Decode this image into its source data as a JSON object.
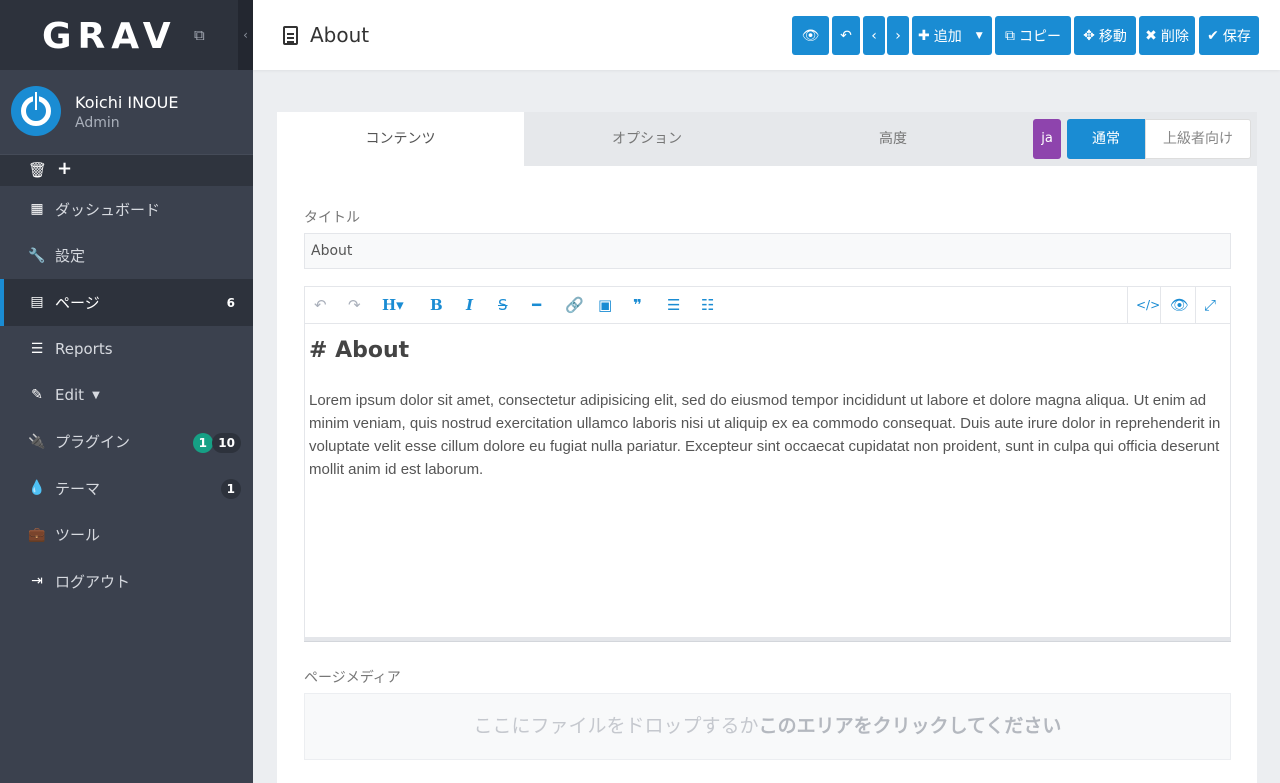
{
  "sidebar": {
    "logo": "GRAV",
    "user": {
      "name": "Koichi INOUE",
      "role": "Admin"
    },
    "items": [
      {
        "label": "ダッシュボード",
        "icon": "grid-icon"
      },
      {
        "label": "設定",
        "icon": "wrench-icon"
      },
      {
        "label": "ページ",
        "icon": "file-icon",
        "badge": "6",
        "active": true
      },
      {
        "label": "Reports",
        "icon": "list-icon"
      },
      {
        "label": "Edit",
        "icon": "edit-icon"
      },
      {
        "label": "プラグイン",
        "icon": "plug-icon",
        "badge_green": "1",
        "badge": "10"
      },
      {
        "label": "テーマ",
        "icon": "drop-icon",
        "badge": "1"
      },
      {
        "label": "ツール",
        "icon": "briefcase-icon"
      },
      {
        "label": "ログアウト",
        "icon": "logout-icon"
      }
    ]
  },
  "header": {
    "title": "About",
    "buttons": {
      "add": "追加",
      "copy": "コピー",
      "move": "移動",
      "delete": "削除",
      "save": "保存"
    }
  },
  "tabs": {
    "content": "コンテンツ",
    "options": "オプション",
    "advanced": "高度",
    "lang": "ja",
    "normal": "通常",
    "expert": "上級者向け"
  },
  "form": {
    "title_label": "タイトル",
    "title_value": "About",
    "editor_heading": "# About",
    "editor_body": "Lorem ipsum dolor sit amet, consectetur adipisicing elit, sed do eiusmod tempor incididunt ut labore et dolore magna aliqua. Ut enim ad minim veniam, quis nostrud exercitation ullamco laboris nisi ut aliquip ex ea commodo consequat. Duis aute irure dolor in reprehenderit in voluptate velit esse cillum dolore eu fugiat nulla pariatur. Excepteur sint occaecat cupidatat non proident, sunt in culpa qui officia deserunt mollit anim id est laborum.",
    "media_label": "ページメディア",
    "dropzone_text": "ここにファイルをドロップするか",
    "dropzone_link": "このエリアをクリックしてください"
  },
  "colors": {
    "accent": "#1a8cd3",
    "sidebar": "#3b414e",
    "lang": "#8e44ad",
    "green_badge": "#16a085"
  }
}
